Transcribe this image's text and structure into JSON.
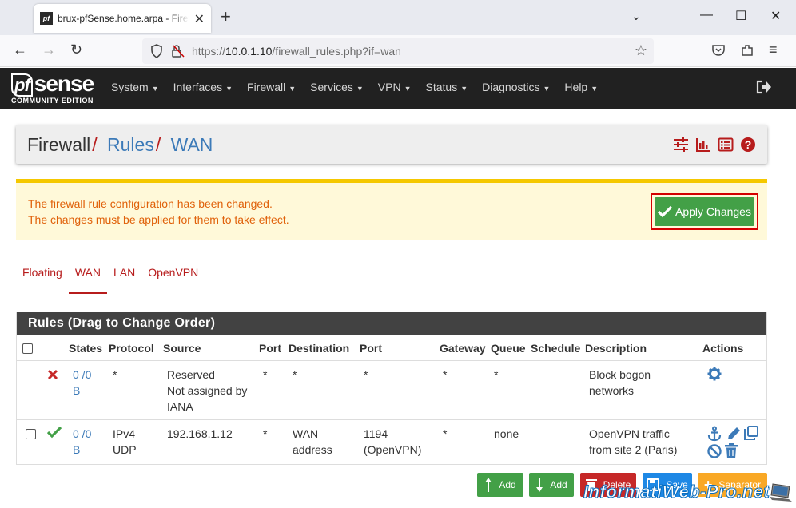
{
  "browser": {
    "tab_title": "brux-pfSense.home.arpa - Firewall: Rules: WAN",
    "tab_favicon": "pf",
    "url_base": "https://",
    "url_host": "10.0.1.10",
    "url_path": "/firewall_rules.php?if=wan"
  },
  "pfsense": {
    "logo_main": "sense",
    "logo_pf": "pf",
    "logo_sub": "COMMUNITY EDITION",
    "menu": [
      "System",
      "Interfaces",
      "Firewall",
      "Services",
      "VPN",
      "Status",
      "Diagnostics",
      "Help"
    ]
  },
  "breadcrumb": {
    "part1": "Firewall",
    "part2": "Rules",
    "part3": "WAN",
    "sep": "/"
  },
  "alert": {
    "line1": "The firewall rule configuration has been changed.",
    "line2": "The changes must be applied for them to take effect.",
    "apply_label": "Apply Changes"
  },
  "tabs": [
    "Floating",
    "WAN",
    "LAN",
    "OpenVPN"
  ],
  "rules": {
    "title": "Rules (Drag to Change Order)",
    "headers": [
      "States",
      "Protocol",
      "Source",
      "Port",
      "Destination",
      "Port",
      "Gateway",
      "Queue",
      "Schedule",
      "Description",
      "Actions"
    ],
    "rows": [
      {
        "states_1": "0 /0",
        "states_2": "B",
        "protocol": "*",
        "source_1": "Reserved",
        "source_2": "Not assigned by",
        "source_3": "IANA",
        "src_port": "*",
        "destination": "*",
        "dst_port": "*",
        "gateway": "*",
        "queue": "*",
        "schedule": "",
        "description_1": "Block bogon",
        "description_2": "networks"
      },
      {
        "states_1": "0 /0",
        "states_2": "B",
        "protocol_1": "IPv4",
        "protocol_2": "UDP",
        "source": "192.168.1.12",
        "src_port": "*",
        "destination_1": "WAN",
        "destination_2": "address",
        "dst_port_1": "1194",
        "dst_port_2": "(OpenVPN)",
        "gateway": "*",
        "queue": "none",
        "schedule": "",
        "description_1": "OpenVPN traffic",
        "description_2": "from site 2 (Paris)"
      }
    ]
  },
  "buttons": {
    "add_top": "Add",
    "add_bottom": "Add",
    "delete": "Delete",
    "save": "Save",
    "separator": "Separator"
  },
  "watermark": "InformatiWeb-Pro.net",
  "colors": {
    "nav_bg": "#212121",
    "brand_red": "#b71c1c",
    "link_blue": "#3c7ab8",
    "success": "#43a047",
    "danger": "#c62828",
    "save_blue": "#1e88e5",
    "warning": "#f9a825"
  }
}
